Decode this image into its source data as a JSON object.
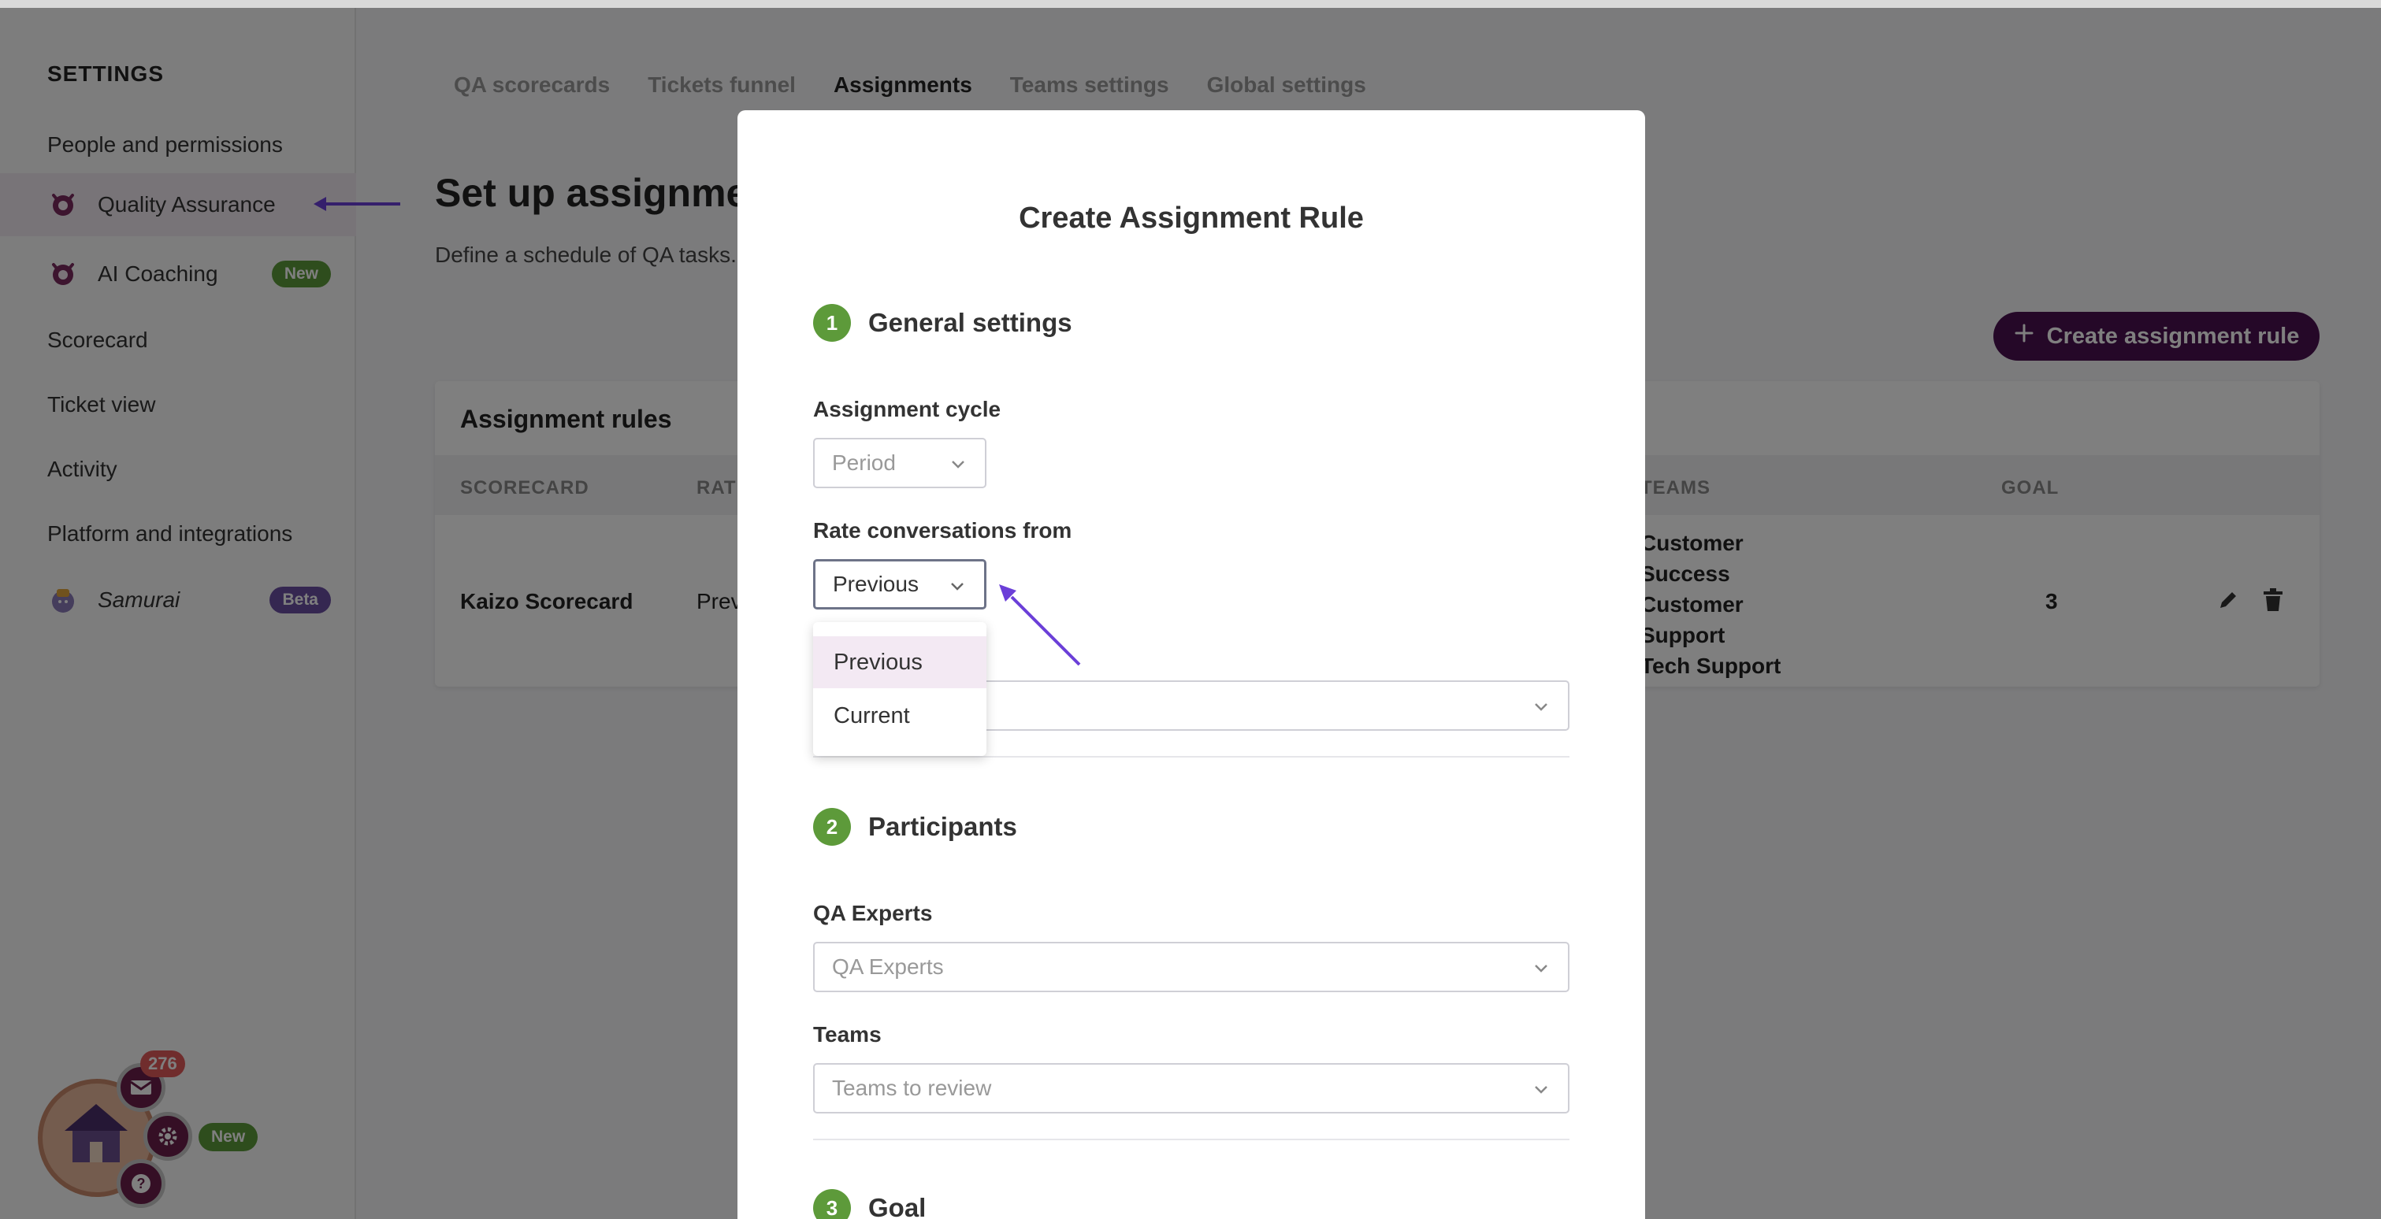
{
  "sidebar": {
    "title": "SETTINGS",
    "items": [
      {
        "label": "People and permissions"
      },
      {
        "label": "Quality Assurance"
      },
      {
        "label": "AI Coaching",
        "badge": "New"
      },
      {
        "label": "Scorecard"
      },
      {
        "label": "Ticket view"
      },
      {
        "label": "Activity"
      },
      {
        "label": "Platform and integrations"
      },
      {
        "label": "Samurai",
        "badge": "Beta"
      }
    ]
  },
  "widget": {
    "count": "276",
    "badge": "New"
  },
  "tabs": [
    "QA scorecards",
    "Tickets funnel",
    "Assignments",
    "Teams settings",
    "Global settings"
  ],
  "page": {
    "title": "Set up assignme",
    "subtitle": "Define a schedule of QA tasks.",
    "create_button": "Create assignment rule"
  },
  "rules": {
    "title": "Assignment rules",
    "columns": [
      "SCORECARD",
      "RATI",
      "TEAMS",
      "GOAL"
    ],
    "row": {
      "scorecard": "Kaizo Scorecard",
      "rate": "Prev",
      "teams": [
        "Customer",
        "Success",
        "Customer",
        "Support",
        "Tech Support"
      ],
      "goal": "3"
    }
  },
  "modal": {
    "title": "Create Assignment Rule",
    "sections": [
      {
        "num": "1",
        "title": "General settings"
      },
      {
        "num": "2",
        "title": "Participants"
      },
      {
        "num": "3",
        "title": "Goal"
      }
    ],
    "assignment_cycle": {
      "label": "Assignment cycle",
      "placeholder": "Period"
    },
    "rate_from": {
      "label": "Rate conversations from",
      "value": "Previous"
    },
    "dropdown_options": [
      "Previous",
      "Current"
    ],
    "qa_experts": {
      "label": "QA Experts",
      "placeholder": "QA Experts"
    },
    "teams": {
      "label": "Teams",
      "placeholder": "Teams to review"
    }
  },
  "colors": {
    "accent": "#4a1050",
    "step_green": "#5d9a3a",
    "arrow": "#6b3fd8"
  }
}
